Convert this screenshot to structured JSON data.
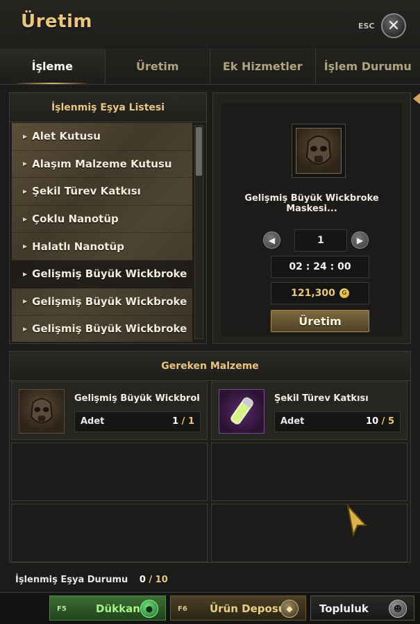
{
  "window": {
    "title": "Üretim",
    "esc_label": "ESC"
  },
  "tabs": [
    {
      "label": "İşleme",
      "active": true
    },
    {
      "label": "Üretim",
      "active": false
    },
    {
      "label": "Ek Hizmetler",
      "active": false
    },
    {
      "label": "İşlem Durumu",
      "active": false
    }
  ],
  "list": {
    "header": "İşlenmiş Eşya Listesi",
    "items": [
      "Alet Kutusu",
      "Alaşım Malzeme Kutusu",
      "Şekil Türev Katkısı",
      "Çoklu Nanotüp",
      "Halatlı Nanotüp",
      "Gelişmiş Büyük Wickbroke",
      "Gelişmiş Büyük Wickbroke",
      "Gelişmiş Büyük Wickbroke"
    ]
  },
  "detail": {
    "item_icon": "wickbroke-mask-icon",
    "item_name": "Gelişmiş Büyük Wickbroke Maskesi...",
    "quantity": "1",
    "time": "02 : 24 : 00",
    "cost": "121,300",
    "coin_glyph": "G",
    "produce_label": "Üretim"
  },
  "materials": {
    "header": "Gereken Malzeme",
    "items": [
      {
        "name": "Gelişmiş Büyük Wickbroke ...",
        "count_label": "Adet",
        "have": "1",
        "sep": "/",
        "need": "1",
        "icon": "wickbroke-mask-icon"
      },
      {
        "name": "Şekil Türev Katkısı",
        "count_label": "Adet",
        "have": "10",
        "sep": "/",
        "need": "5",
        "icon": "additive-tube-icon"
      }
    ]
  },
  "status": {
    "label": "İşlenmiş Eşya Durumu",
    "current": "0",
    "sep": "/",
    "max": "10"
  },
  "bottom": {
    "shop": {
      "key": "F5",
      "label": "Dükkan"
    },
    "depot": {
      "key": "F6",
      "label": "Ürün Deposu"
    },
    "community": {
      "label": "Topluluk"
    }
  },
  "colors": {
    "accent_gold": "#e9c77e",
    "shop_green": "#a9f28a",
    "panel_bg": "#1f1e1c"
  }
}
